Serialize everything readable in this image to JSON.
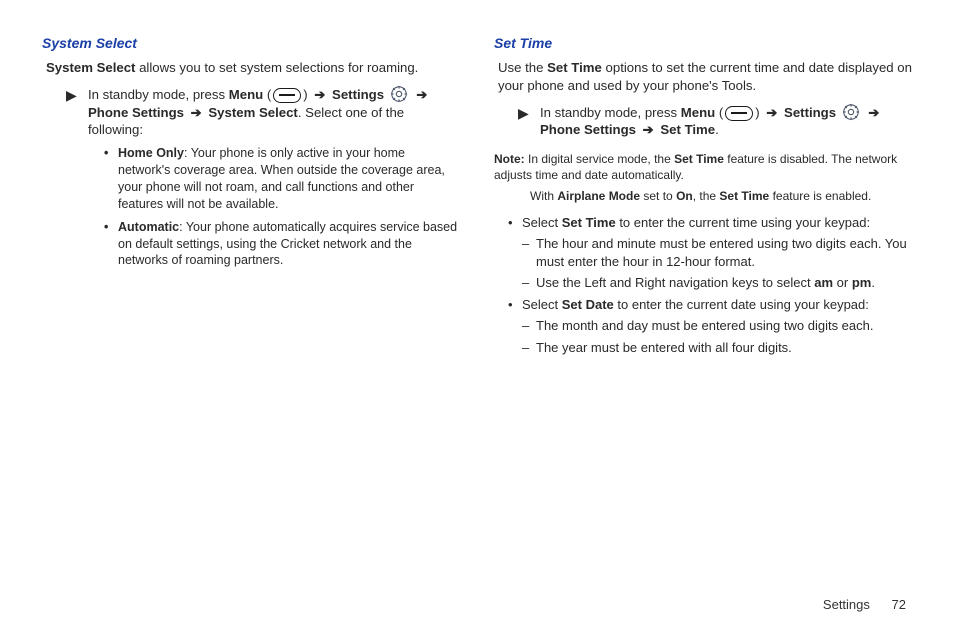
{
  "left": {
    "heading": "System Select",
    "intro_lead": "System Select",
    "intro_rest": " allows you to set system selections for roaming.",
    "step_prefix": "In standby mode, press ",
    "menu": "Menu",
    "settings": "Settings",
    "psettings": "Phone Settings",
    "syssel": "System Select",
    "step_suffix": ". Select one of the following:",
    "home_lead": "Home Only",
    "home_rest": ": Your phone is only active in your home network's coverage area. When outside the coverage area, your phone will not roam, and call functions and other features will not be available.",
    "auto_lead": "Automatic",
    "auto_rest": ": Your phone automatically acquires service based on default settings, using the Cricket network and the networks of roaming partners."
  },
  "right": {
    "heading": "Set Time",
    "intro_pre": "Use the ",
    "intro_bold": "Set Time",
    "intro_post": " options to set the current time and date displayed on your phone and used by your phone's Tools.",
    "step_prefix": "In standby mode, press ",
    "menu": "Menu",
    "settings": "Settings",
    "psettings": "Phone Settings",
    "settime": "Set Time",
    "note_label": "Note:",
    "note1a": " In digital service mode, the ",
    "note1b": "Set Time",
    "note1c": " feature is disabled. The network adjusts time and date automatically.",
    "note2a": "With ",
    "note2b": "Airplane Mode",
    "note2c": " set to ",
    "note2d": "On",
    "note2e": ", the ",
    "note2f": "Set Time",
    "note2g": " feature is enabled.",
    "b1a": "Select ",
    "b1b": "Set Time",
    "b1c": " to enter the current time using your keypad:",
    "s1": "The hour and minute must be entered using two digits each. You must enter the hour in 12-hour format.",
    "s2a": "Use the Left and Right navigation keys to select ",
    "s2b": "am",
    "s2c": " or ",
    "s2d": "pm",
    "s2e": ".",
    "b2a": "Select ",
    "b2b": "Set Date",
    "b2c": " to enter the current date using your keypad:",
    "s3": "The month and day must be entered using two digits each.",
    "s4": "The year must be entered with all four digits."
  },
  "footer": {
    "section": "Settings",
    "page": "72"
  }
}
